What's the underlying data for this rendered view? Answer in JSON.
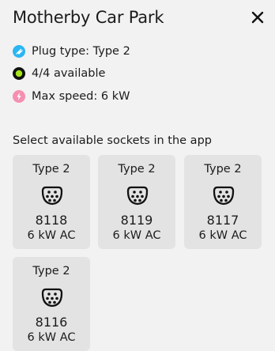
{
  "header": {
    "title": "Motherby Car Park",
    "close_icon": "close-icon"
  },
  "info": [
    {
      "icon": "plug-icon",
      "color": "#2bb6f2",
      "text": "Plug type: Type 2"
    },
    {
      "icon": "availability-dot-icon",
      "color": "#a6e61a",
      "text": "4/4 available"
    },
    {
      "icon": "lightning-icon",
      "color": "#f58fb0",
      "text": "Max speed: 6 kW"
    }
  ],
  "sockets_heading": "Select available sockets in the app",
  "sockets": [
    {
      "type": "Type 2",
      "icon": "type2-socket-icon",
      "id": "8118",
      "speed": "6 kW AC"
    },
    {
      "type": "Type 2",
      "icon": "type2-socket-icon",
      "id": "8119",
      "speed": "6 kW AC"
    },
    {
      "type": "Type 2",
      "icon": "type2-socket-icon",
      "id": "8117",
      "speed": "6 kW AC"
    },
    {
      "type": "Type 2",
      "icon": "type2-socket-icon",
      "id": "8116",
      "speed": "6 kW AC"
    }
  ]
}
